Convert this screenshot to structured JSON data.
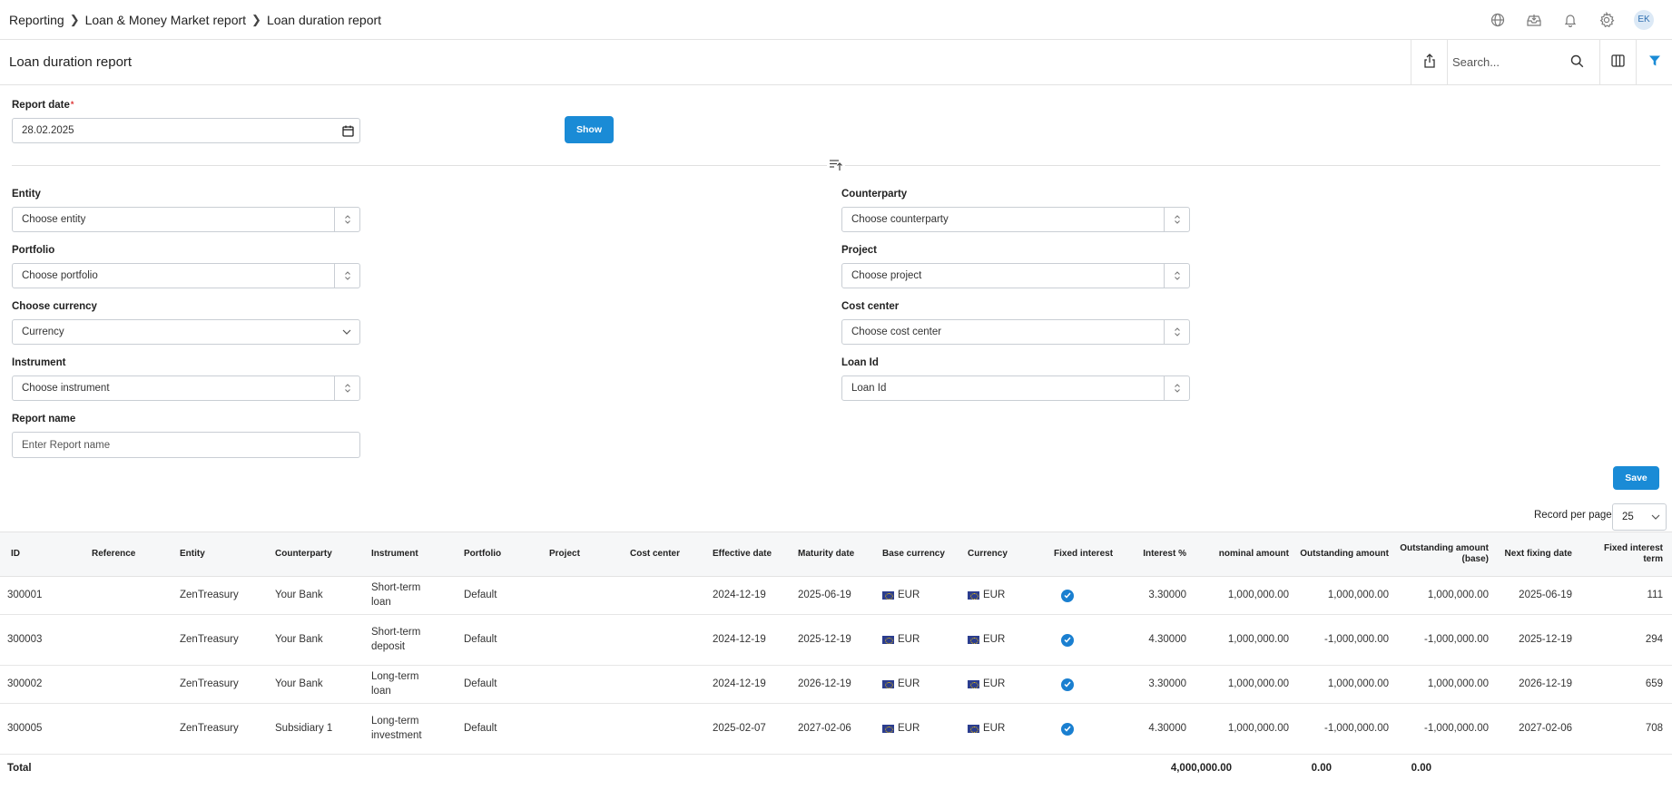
{
  "breadcrumb": [
    "Reporting",
    "Loan & Money Market report",
    "Loan duration report"
  ],
  "user_initials": "EK",
  "page_title": "Loan duration report",
  "search_placeholder": "Search...",
  "form": {
    "report_date_label": "Report date",
    "report_date_value": "28.02.2025",
    "show_label": "Show",
    "entity_label": "Entity",
    "entity_placeholder": "Choose entity",
    "portfolio_label": "Portfolio",
    "portfolio_placeholder": "Choose portfolio",
    "currency_label": "Choose currency",
    "currency_value": "Currency",
    "instrument_label": "Instrument",
    "instrument_placeholder": "Choose instrument",
    "report_name_label": "Report name",
    "report_name_placeholder": "Enter Report name",
    "counterparty_label": "Counterparty",
    "counterparty_placeholder": "Choose counterparty",
    "project_label": "Project",
    "project_placeholder": "Choose project",
    "cost_center_label": "Cost center",
    "cost_center_placeholder": "Choose cost center",
    "loan_id_label": "Loan Id",
    "loan_id_placeholder": "Loan Id",
    "save_label": "Save"
  },
  "records_per_page_label": "Record per page",
  "records_per_page_value": "25",
  "table": {
    "columns": [
      "ID",
      "Reference",
      "Entity",
      "Counterparty",
      "Instrument",
      "Portfolio",
      "Project",
      "Cost center",
      "Effective date",
      "Maturity date",
      "Base currency",
      "Currency",
      "Fixed interest",
      "Interest %",
      "nominal amount",
      "Outstanding amount",
      "Outstanding amount (base)",
      "Next fixing date",
      "Fixed interest term"
    ],
    "rows": [
      {
        "id": "300001",
        "reference": "",
        "entity": "ZenTreasury",
        "counterparty": "Your Bank",
        "instrument": "Short-term loan",
        "portfolio": "Default",
        "project": "",
        "cost_center": "",
        "effective_date": "2024-12-19",
        "maturity_date": "2025-06-19",
        "base_currency": "EUR",
        "currency": "EUR",
        "fixed_interest": true,
        "interest": "3.30000",
        "nominal": "1,000,000.00",
        "outstanding": "1,000,000.00",
        "outstanding_base": "1,000,000.00",
        "next_fixing": "2025-06-19",
        "term": "111"
      },
      {
        "id": "300003",
        "reference": "",
        "entity": "ZenTreasury",
        "counterparty": "Your Bank",
        "instrument": "Short-term deposit",
        "portfolio": "Default",
        "project": "",
        "cost_center": "",
        "effective_date": "2024-12-19",
        "maturity_date": "2025-12-19",
        "base_currency": "EUR",
        "currency": "EUR",
        "fixed_interest": true,
        "interest": "4.30000",
        "nominal": "1,000,000.00",
        "outstanding": "-1,000,000.00",
        "outstanding_base": "-1,000,000.00",
        "next_fixing": "2025-12-19",
        "term": "294"
      },
      {
        "id": "300002",
        "reference": "",
        "entity": "ZenTreasury",
        "counterparty": "Your Bank",
        "instrument": "Long-term loan",
        "portfolio": "Default",
        "project": "",
        "cost_center": "",
        "effective_date": "2024-12-19",
        "maturity_date": "2026-12-19",
        "base_currency": "EUR",
        "currency": "EUR",
        "fixed_interest": true,
        "interest": "3.30000",
        "nominal": "1,000,000.00",
        "outstanding": "1,000,000.00",
        "outstanding_base": "1,000,000.00",
        "next_fixing": "2026-12-19",
        "term": "659"
      },
      {
        "id": "300005",
        "reference": "",
        "entity": "ZenTreasury",
        "counterparty": "Subsidiary 1",
        "instrument": "Long-term investment",
        "portfolio": "Default",
        "project": "",
        "cost_center": "",
        "effective_date": "2025-02-07",
        "maturity_date": "2027-02-06",
        "base_currency": "EUR",
        "currency": "EUR",
        "fixed_interest": true,
        "interest": "4.30000",
        "nominal": "1,000,000.00",
        "outstanding": "-1,000,000.00",
        "outstanding_base": "-1,000,000.00",
        "next_fixing": "2027-02-06",
        "term": "708"
      }
    ],
    "total": {
      "label": "Total",
      "nominal": "4,000,000.00",
      "outstanding": "0.00",
      "outstanding_base": "0.00"
    }
  },
  "colors": {
    "accent": "#1a8bd6",
    "check": "#1a7fd0"
  },
  "icons": [
    "globe-icon",
    "download-tray-icon",
    "bell-icon",
    "gear-icon",
    "share-icon",
    "search-icon",
    "columns-icon",
    "filter-icon",
    "calendar-icon",
    "collapse-filter-icon",
    "spinner-icon",
    "chevron-down-icon",
    "check-circle-icon",
    "eu-flag-icon"
  ]
}
